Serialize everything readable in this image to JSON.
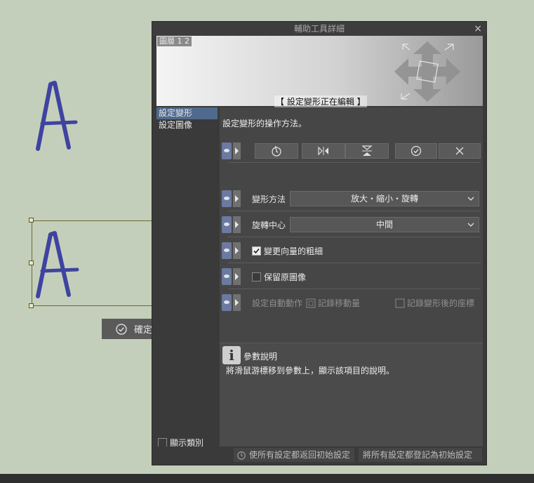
{
  "canvas": {
    "letter": "A",
    "confirm_label": "確定"
  },
  "dialog": {
    "title": "輔助工具詳細",
    "close_glyph": "×",
    "preview": {
      "layer_tag": "圖層 1 2",
      "edit_tag": "【 設定變形正在編輯 】"
    },
    "sidebar": {
      "items": [
        {
          "label": "設定變形",
          "active": true
        },
        {
          "label": "設定圖像",
          "active": false
        }
      ],
      "show_category_label": "顯示類別"
    },
    "content": {
      "description": "設定變形的操作方法。",
      "toolbar_icons": [
        "reset-icon",
        "flip-horizontal-icon",
        "flip-vertical-icon",
        "confirm-icon",
        "cancel-icon"
      ],
      "transform_method": {
        "label": "變形方法",
        "value": "放大・縮小・旋轉"
      },
      "rotation_center": {
        "label": "旋轉中心",
        "value": "中間"
      },
      "change_vector_width": {
        "label": "變更向量的粗細",
        "checked": true
      },
      "keep_original": {
        "label": "保留原圖像",
        "checked": false
      },
      "auto_action": {
        "label": "設定自動動作",
        "option1": "記錄移動量",
        "option2": "記錄變形後的座標"
      }
    },
    "help": {
      "title": "參數說明",
      "text": "將滑鼠游標移到參數上，顯示該項目的說明。"
    },
    "footer": {
      "reset_all": "使所有設定都返回初始設定",
      "register_all": "將所有設定都登記為初始設定"
    }
  }
}
